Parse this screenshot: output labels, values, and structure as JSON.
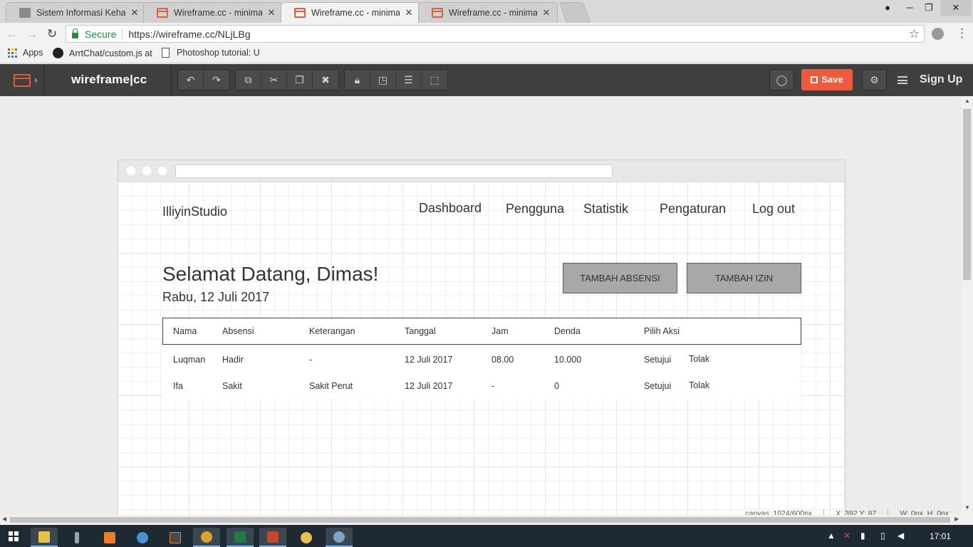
{
  "browser": {
    "tabs": [
      {
        "title": "Sistem Informasi Kehadir",
        "icon": "document-icon",
        "active": false
      },
      {
        "title": "Wireframe.cc - minimal w",
        "icon": "wireframe-icon",
        "active": false
      },
      {
        "title": "Wireframe.cc - minimal w",
        "icon": "wireframe-icon",
        "active": true
      },
      {
        "title": "Wireframe.cc - minimal w",
        "icon": "wireframe-icon",
        "active": false
      }
    ],
    "secure_label": "Secure",
    "url": "https://wireframe.cc/NLjLBg",
    "bookmarks": [
      {
        "label": "Apps",
        "icon": "apps-grid-icon"
      },
      {
        "label": "ArrtChat/custom.js at",
        "icon": "github-icon"
      },
      {
        "label": "Photoshop tutorial: U",
        "icon": "page-icon"
      }
    ]
  },
  "toolbar": {
    "logo": "wireframe|cc",
    "save_label": "Save",
    "signup_label": "Sign Up",
    "accent": "#ef5a3c"
  },
  "status": {
    "canvas": "canvas: 1024/600px",
    "coords": "X: 392 Y: 87",
    "size": "W: 0px, H: 0px"
  },
  "mockup": {
    "brand": "IlliyinStudio",
    "nav": [
      "Dashboard",
      "Pengguna",
      "Statistik",
      "Pengaturan",
      "Log out"
    ],
    "welcome": "Selamat Datang, Dimas!",
    "date": "Rabu, 12 Juli 2017",
    "buttons": [
      "TAMBAH ABSENSI",
      "TAMBAH IZIN"
    ],
    "table": {
      "headers": [
        "Nama",
        "Absensi",
        "Keterangan",
        "Tanggal",
        "Jam",
        "Denda",
        "Pilih Aksi"
      ],
      "rows": [
        {
          "nama": "Luqman",
          "absensi": "Hadir",
          "keterangan": "-",
          "tanggal": "12 Juli 2017",
          "jam": "08.00",
          "denda": "10.000",
          "setujui": "Setujui",
          "tolak": "Tolak"
        },
        {
          "nama": "Ifa",
          "absensi": "Sakit",
          "keterangan": "Sakit Perut",
          "tanggal": "12 Juli 2017",
          "jam": "-",
          "denda": "0",
          "setujui": "Setujui",
          "tolak": "Tolak"
        }
      ]
    }
  },
  "taskbar": {
    "clock": "17:01"
  }
}
